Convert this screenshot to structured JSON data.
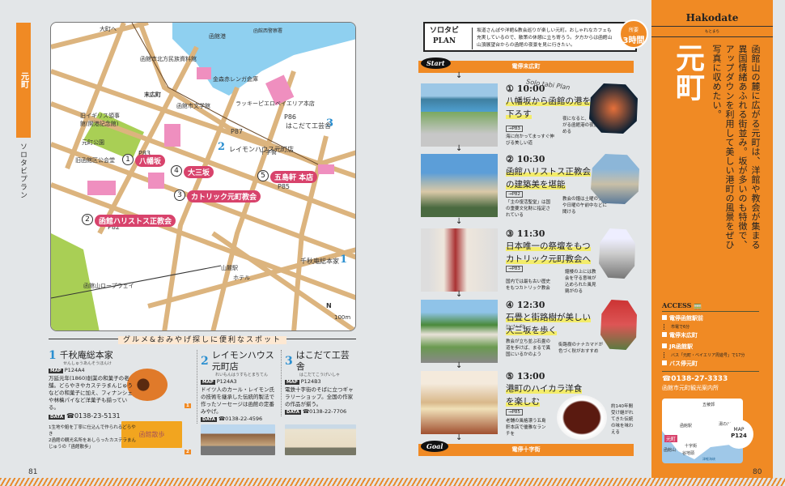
{
  "left_page": {
    "tab_label": "元町",
    "section_label": "ソロタビプラン",
    "page_number": "81",
    "map": {
      "labels": [
        "大町へ",
        "函館西警察署",
        "函館港",
        "函館市北方民族資料館",
        "金森赤レンガ倉庫",
        "末広町",
        "旧イギリス領事館(開港記念館)",
        "元町公園",
        "函館市文学館",
        "旧函館区公会堂",
        "元町",
        "ラッキーピエロベイエリア本店",
        "十字街",
        "千秋庵総本家",
        "山麓駅",
        "函館山ロープウェイ",
        "ホテル",
        "大三坂",
        "P83",
        "P82",
        "P87",
        "P86",
        "P85",
        "100m",
        "N",
        "函館区公会堂"
      ],
      "pins": [
        "八幡坂",
        "函館ハリストス正教会",
        "カトリック元町教会",
        "大三坂",
        "五島軒 本店"
      ],
      "pin_numbers": [
        "1",
        "2",
        "3",
        "4",
        "5"
      ],
      "shops": [
        "はこだて工芸舎",
        "レイモンハウス元町店",
        "千秋庵総本家"
      ],
      "shop_numbers": [
        "3",
        "2",
        "1"
      ]
    },
    "spots_title": "グルメ&おみやげ探しに便利なスポット",
    "spots": [
      {
        "num": "1",
        "name": "千秋庵総本家",
        "kana": "せんしゅうあんそうほんけ",
        "map_tag": "MAP",
        "map": "P124A4",
        "desc": "万延元年(1860)創業の和菓子の老舗。どらやきやカステラまんじゅうなどの和菓子に加え、フィナンシェや林檎パイなど洋菓子も揃っている。",
        "data_tag": "DATA",
        "tel": "☎0138-23-5131",
        "caption1": "1生地や餡を丁寧に仕込んで作られるどらやき",
        "caption2": "2函館の観光名所をあしらったカステラまんじゅうの「函館散歩」",
        "box_text": "函館散歩",
        "photo_nums": [
          "1",
          "2"
        ]
      },
      {
        "num": "2",
        "name": "レイモンハウス元町店",
        "kana": "れいもんはうすもとまちてん",
        "map_tag": "MAP",
        "map": "P124A3",
        "desc": "ドイツ人のカール・レイモン氏の技術を継承した伝統的製法で作ったソーセージは函館の定番みやげ。",
        "data_tag": "DATA",
        "tel": "☎0138-22-4596"
      },
      {
        "num": "3",
        "name": "はこだて工芸舎",
        "kana": "はこだてこうげいしゃ",
        "map_tag": "MAP",
        "map": "P124B3",
        "desc": "電鉄十字街のそばに立つギャラリーショップ。全国の作家の作品が揃う。",
        "data_tag": "DATA",
        "tel": "☎0138-22-7706"
      }
    ]
  },
  "plan": {
    "title_top": "ソロタビ",
    "title_bottom": "PLAN",
    "desc": "坂道さんぽや洋館&教会巡りが楽しい元町。おしゃれなカフェも充実しているので、散策の休憩に立ち寄ろう。夕方からは函館山山頂展望台からの函館の夜景を見に行きたい。",
    "duration_label": "所要",
    "duration": "3時間",
    "start_label": "Start",
    "start_station": "電停末広町",
    "script": "Solo tabi Plan",
    "steps": [
      {
        "time": "① 10:00",
        "title_hl": "八幡坂",
        "title_rest": "から函館の港を見下ろす",
        "ref": "→P83",
        "cap1": "海に向かってまっすぐ伸びる美しい道",
        "cap2": "夜になると、坂下に広がる函館港の夜景が望める"
      },
      {
        "time": "② 10:30",
        "title_hl": "函館ハリストス正教会",
        "title_rest": "の建築美を堪能",
        "ref": "→P82",
        "cap1": "「主の復活聖堂」は国の重要文化財に指定されている",
        "cap2": "教会の鐘は土曜の夕方や日曜の午前中などに聞ける"
      },
      {
        "time": "③ 11:30",
        "title_hl": "",
        "title_rest": "日本唯一の祭壇をもつ",
        "title_hl2": "カトリック元町教会",
        "title_rest2": "へ",
        "ref": "→P83",
        "cap1": "国内では最も古い歴史をもつカトリック教会",
        "cap2": "鐘楼の上には教会を守る意味が込められた風見鶏がのる"
      },
      {
        "time": "④ 12:30",
        "title_hl": "",
        "title_rest": "石畳と街路樹が美しい",
        "title_hl2": "大三坂",
        "title_rest2": "を歩く",
        "ruby": "だいさんざか",
        "ref": "",
        "cap1": "教会が立ち並ぶ石畳の道を歩けば、まるで異国にいるかのよう",
        "cap2": "街路樹のナナカマドが色づく秋がおすすめ"
      },
      {
        "time": "⑤ 13:00",
        "title_hl": "港町のハイカラ洋食",
        "title_rest": "を楽しむ",
        "ref": "→P85",
        "cap1": "老舗の風格漂う五島軒本店で優雅なランチを",
        "cap2": "約140年間受け継がれてきた伝統の味を味わえる"
      }
    ],
    "goal_label": "Goal",
    "goal_station": "電停十字街"
  },
  "sidebar": {
    "area": "Hakodate",
    "reading": "もとまち",
    "title": "元町",
    "lead": "函館山の麓に広がる元町は、洋館や教会が集まる異国情緒あふれる街並み。坂が多いのも特徴で、アップダウンを利用して美しい港町の風景をぜひ写真に収めたい。",
    "access_title": "ACCESS",
    "routes": [
      {
        "from": "電停函館駅前",
        "via": "市電で6分",
        "to": "電停末広町"
      },
      {
        "from": "JR函館駅",
        "via": "バス「元町・ベイエリア周遊号」で17分",
        "to": "バス停元町"
      }
    ],
    "tel": "☎0138-27-3333",
    "tel_name": "函館市元町観光案内所",
    "minimap_labels": [
      "五稜郭",
      "函館駅",
      "元町",
      "十字街",
      "谷地頭",
      "函館山",
      "湯の川温泉",
      "津軽海峡"
    ],
    "map_button_label": "MAP",
    "map_button_page": "P124",
    "page_number": "80"
  },
  "colors": {
    "accent": "#f08a24",
    "pin": "#d8436c",
    "number_blue": "#2b8fd0",
    "highlight": "#f3ec6a"
  }
}
